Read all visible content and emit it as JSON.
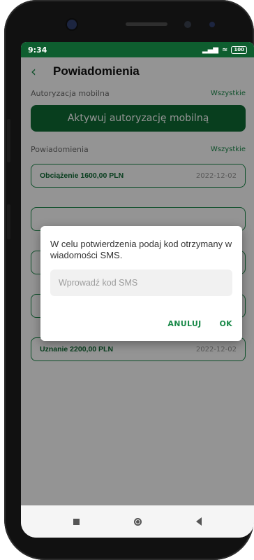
{
  "status_bar": {
    "time": "9:34",
    "signal": "▂▄▆",
    "wifi": "≈",
    "battery": "100"
  },
  "header": {
    "back_icon": "arrow-left-icon",
    "title": "Powiadomienia"
  },
  "mobile_auth": {
    "label": "Autoryzacja mobilna",
    "link": "Wszystkie",
    "button": "Aktywuj autoryzację mobilną"
  },
  "notifications": {
    "label": "Powiadomienia",
    "link": "Wszystkie",
    "items": [
      {
        "title": "Obciążenie 1600,00 PLN",
        "date": "2022-12-02"
      },
      {
        "title": "",
        "date": ""
      },
      {
        "title": "",
        "date": ""
      },
      {
        "title": "",
        "date": ""
      },
      {
        "title": "Uznanie 2200,00 PLN",
        "date": "2022-12-02"
      }
    ]
  },
  "dialog": {
    "message": "W celu potwierdzenia podaj kod otrzymany w wiadomości SMS.",
    "input_placeholder": "Wprowadź kod SMS",
    "cancel_label": "ANULUJ",
    "ok_label": "OK"
  },
  "colors": {
    "accent": "#1b8a4a",
    "dark_accent": "#0e6b35",
    "status_bar": "#0e5e2f"
  }
}
